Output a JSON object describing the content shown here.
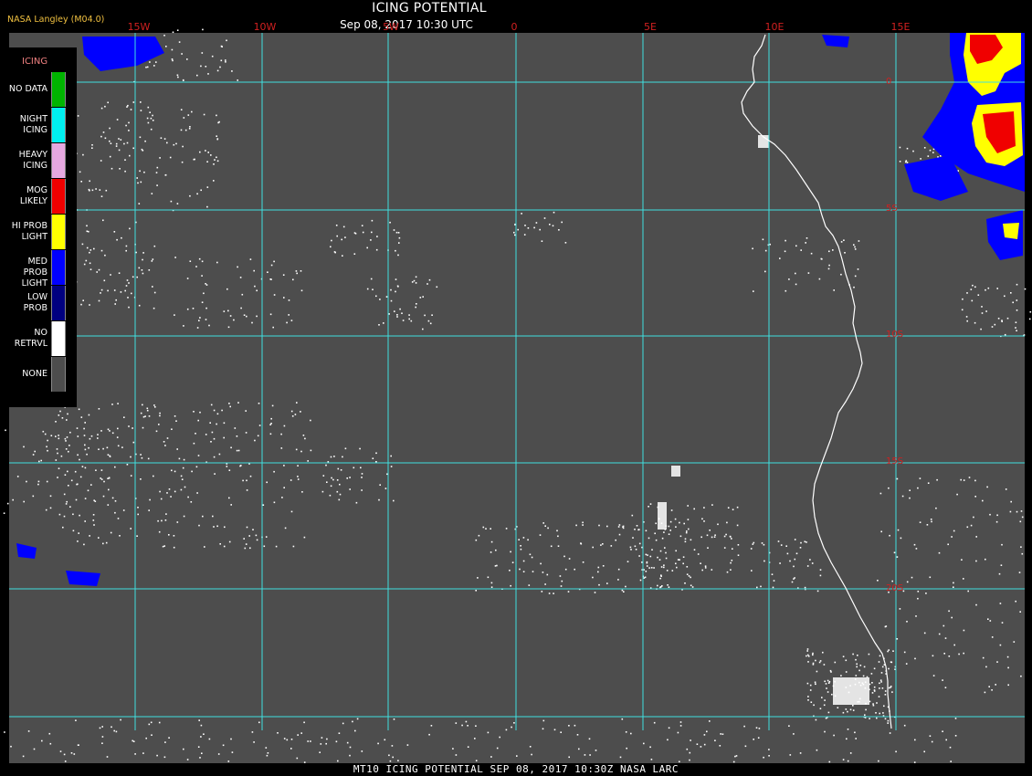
{
  "header": {
    "title": "ICING POTENTIAL",
    "datetime": "Sep 08, 2017 10:30 UTC",
    "source": "NASA Langley (M04.0)"
  },
  "map": {
    "background_color": "#4d4d4d",
    "grid_color": "#40e0e0",
    "coastline_color": "#ffffff",
    "longitude_labels": [
      "15W",
      "10W",
      "5W",
      "0",
      "5E",
      "10E",
      "15E"
    ],
    "latitude_labels": [
      "0",
      "5S",
      "10S",
      "15S",
      "20S"
    ]
  },
  "legend": {
    "title": "ICING",
    "items": [
      {
        "label": "NO DATA",
        "color": "#00b400"
      },
      {
        "label": "NIGHT ICING",
        "color": "#00f0f0"
      },
      {
        "label": "HEAVY ICING",
        "color": "#e6a8e0"
      },
      {
        "label": "MOG LIKELY",
        "color": "#f00000"
      },
      {
        "label": "HI PROB LIGHT",
        "color": "#ffff00"
      },
      {
        "label": "MED PROB LIGHT",
        "color": "#0000ff"
      },
      {
        "label": "LOW PROB",
        "color": "#000080"
      },
      {
        "label": "NO RETRVL",
        "color": "#ffffff"
      },
      {
        "label": "NONE",
        "color": "#4d4d4d"
      }
    ],
    "label_lines": [
      [
        "NO DATA"
      ],
      [
        "NIGHT",
        "ICING"
      ],
      [
        "HEAVY",
        "ICING"
      ],
      [
        "MOG",
        "LIKELY"
      ],
      [
        "HI PROB",
        "LIGHT"
      ],
      [
        "MED PROB",
        "LIGHT"
      ],
      [
        "LOW",
        "PROB"
      ],
      [
        "NO",
        "RETRVL"
      ],
      [
        "NONE"
      ]
    ]
  },
  "footer": {
    "text": "MT10  ICING POTENTIAL   SEP 08, 2017 10:30Z   NASA LARC"
  }
}
